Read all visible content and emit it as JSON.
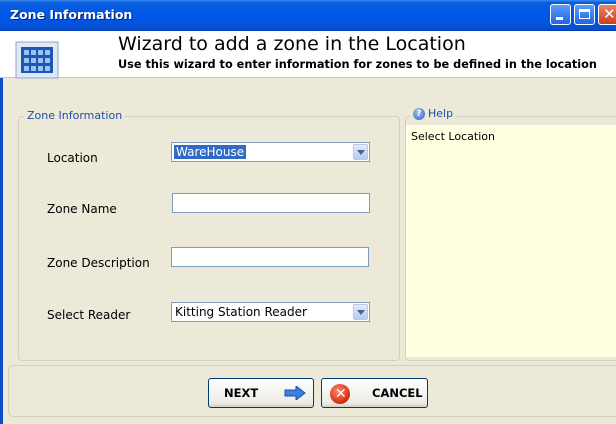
{
  "window": {
    "title": "Zone Information"
  },
  "banner": {
    "title": "Wizard to add a zone in the Location",
    "subtitle": "Use this wizard to enter information for zones to be defined in the location",
    "icon": "building-icon"
  },
  "zone_group": {
    "legend": "Zone Information",
    "location_label": "Location",
    "location_value": "WareHouse",
    "zone_name_label": "Zone Name",
    "zone_name_value": "",
    "zone_description_label": "Zone Description",
    "zone_description_value": "",
    "reader_label": "Select Reader",
    "reader_value": "Kitting Station Reader"
  },
  "help": {
    "legend": "Help",
    "text": "Select Location"
  },
  "buttons": {
    "next_label": "NEXT",
    "cancel_label": "CANCEL"
  },
  "colors": {
    "titlebar": "#0055e5",
    "window_bg": "#ece9d8",
    "help_bg": "#ffffe1",
    "selection": "#316ac5"
  }
}
